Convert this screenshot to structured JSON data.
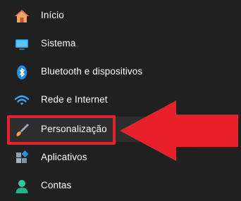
{
  "nav": {
    "items": [
      {
        "label": "Início",
        "icon": "home-icon"
      },
      {
        "label": "Sistema",
        "icon": "system-display-icon"
      },
      {
        "label": "Bluetooth e dispositivos",
        "icon": "bluetooth-icon"
      },
      {
        "label": "Rede e Internet",
        "icon": "wifi-icon"
      },
      {
        "label": "Personalização",
        "icon": "paintbrush-icon",
        "selected": true
      },
      {
        "label": "Aplicativos",
        "icon": "apps-icon"
      },
      {
        "label": "Contas",
        "icon": "person-icon"
      }
    ]
  },
  "annotation": {
    "highlight_color": "#e8202a",
    "arrow_color": "#e8202a"
  },
  "colors": {
    "background": "#202020",
    "selected_background": "#2d2d2d",
    "text": "#ffffff",
    "accent_blue": "#1e90ff"
  }
}
